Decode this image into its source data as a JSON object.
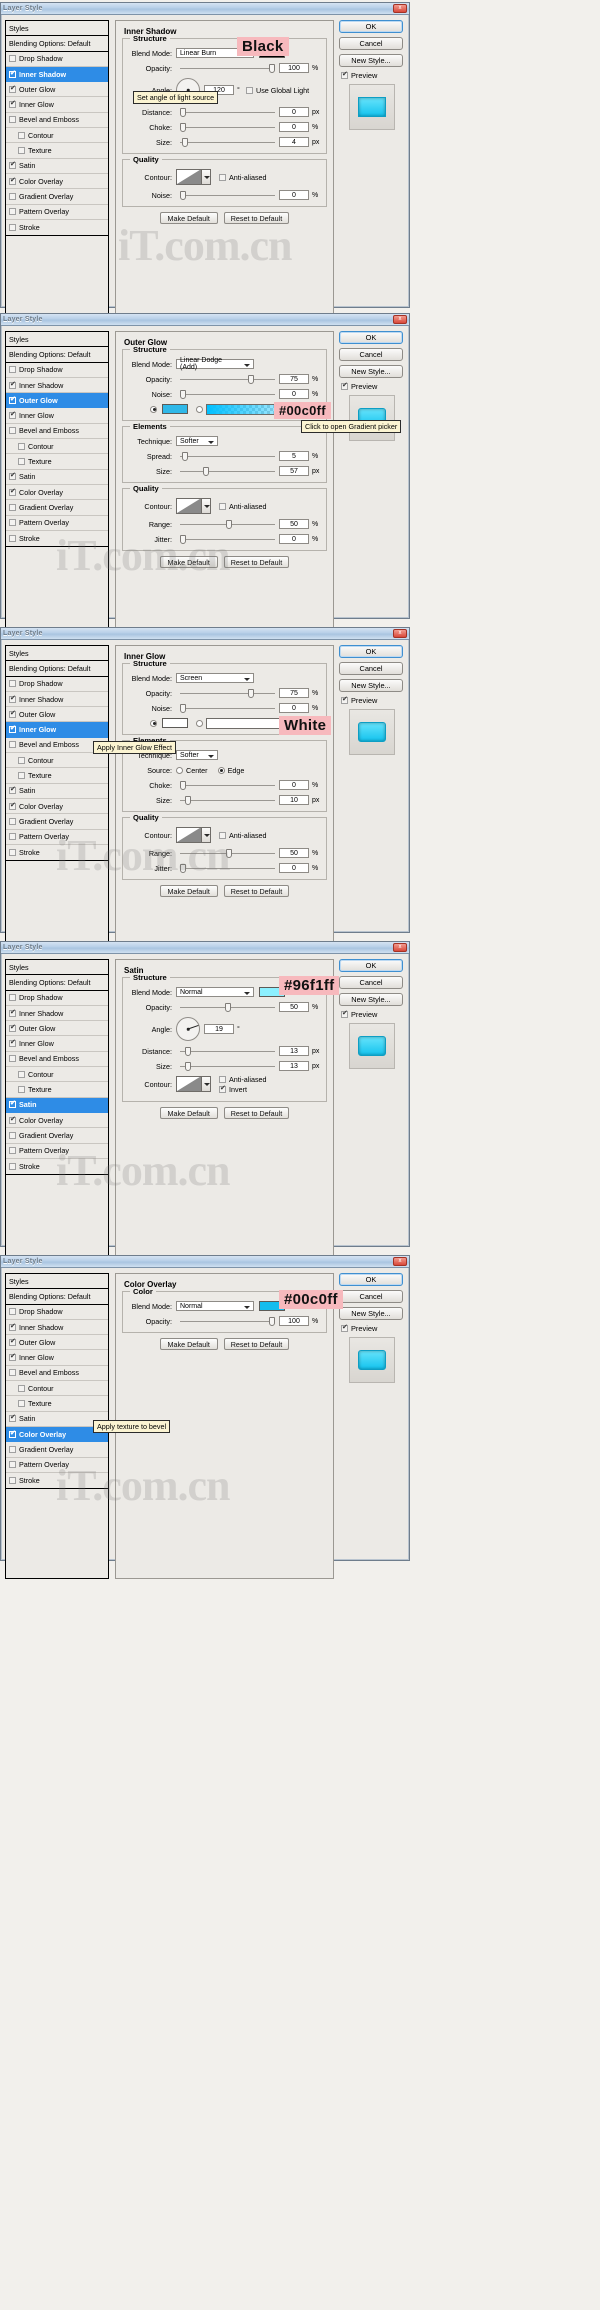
{
  "window": {
    "title": "Layer Style",
    "close_label": "x"
  },
  "styles_panel": {
    "header": "Styles",
    "subheader": "Blending Options: Default",
    "items": [
      {
        "label": "Drop Shadow",
        "checked": false,
        "indent": false
      },
      {
        "label": "Inner Shadow",
        "checked": true,
        "indent": false
      },
      {
        "label": "Outer Glow",
        "checked": true,
        "indent": false
      },
      {
        "label": "Inner Glow",
        "checked": true,
        "indent": false
      },
      {
        "label": "Bevel and Emboss",
        "checked": false,
        "indent": false
      },
      {
        "label": "Contour",
        "checked": false,
        "indent": true
      },
      {
        "label": "Texture",
        "checked": false,
        "indent": true
      },
      {
        "label": "Satin",
        "checked": true,
        "indent": false
      },
      {
        "label": "Color Overlay",
        "checked": true,
        "indent": false
      },
      {
        "label": "Gradient Overlay",
        "checked": false,
        "indent": false
      },
      {
        "label": "Pattern Overlay",
        "checked": false,
        "indent": false
      },
      {
        "label": "Stroke",
        "checked": false,
        "indent": false
      }
    ]
  },
  "buttons": {
    "ok": "OK",
    "cancel": "Cancel",
    "new_style": "New Style...",
    "preview": "Preview",
    "make_default": "Make Default",
    "reset_default": "Reset to Default"
  },
  "labels": {
    "structure": "Structure",
    "quality": "Quality",
    "elements": "Elements",
    "color": "Color",
    "blend_mode": "Blend Mode:",
    "opacity": "Opacity:",
    "noise": "Noise:",
    "angle": "Angle:",
    "distance": "Distance:",
    "choke": "Choke:",
    "size": "Size:",
    "spread": "Spread:",
    "contour": "Contour:",
    "technique": "Technique:",
    "source": "Source:",
    "range": "Range:",
    "jitter": "Jitter:",
    "anti_aliased": "Anti-aliased",
    "use_global_light": "Use Global Light",
    "invert": "Invert",
    "center": "Center",
    "edge": "Edge",
    "pct": "%",
    "px": "px",
    "deg": "°"
  },
  "watermark": "iT.com.cn",
  "panels": [
    {
      "id": "inner-shadow",
      "section_title": "Inner Shadow",
      "selected_style": "Inner Shadow",
      "blend_mode": "Linear Burn",
      "swatch_color": "#000000",
      "annotation": "Black",
      "tooltip": "Set angle of light source",
      "opacity": "100",
      "angle": "120",
      "angle_deg": 120,
      "distance": "0",
      "choke": "0",
      "size": "4",
      "noise": "0",
      "technique": null,
      "spread": null,
      "range": null,
      "jitter": null
    },
    {
      "id": "outer-glow",
      "section_title": "Outer Glow",
      "selected_style": "Outer Glow",
      "blend_mode": "Linear Dodge (Add)",
      "swatch_color": "#00c0ff",
      "annotation": "#00c0ff",
      "tooltip": "Click to open Gradient picker",
      "opacity": "75",
      "noise": "0",
      "technique": "Softer",
      "spread": "5",
      "size": "57",
      "range": "50",
      "jitter": "0"
    },
    {
      "id": "inner-glow",
      "section_title": "Inner Glow",
      "selected_style": "Inner Glow",
      "blend_mode": "Screen",
      "swatch_color": "#ffffff",
      "annotation": "White",
      "tooltip": "Apply Inner Glow Effect",
      "opacity": "75",
      "noise": "0",
      "technique": "Softer",
      "source_center": "Center",
      "source_edge": "Edge",
      "choke": "0",
      "size": "10",
      "range": "50",
      "jitter": "0"
    },
    {
      "id": "satin",
      "section_title": "Satin",
      "selected_style": "Satin",
      "blend_mode": "Normal",
      "swatch_color": "#96f1ff",
      "annotation": "#96f1ff",
      "tooltip": null,
      "opacity": "50",
      "angle": "19",
      "angle_deg": 19,
      "distance": "13",
      "size": "13",
      "invert": true,
      "anti_aliased": false
    },
    {
      "id": "color-overlay",
      "section_title": "Color Overlay",
      "selected_style": "Color Overlay",
      "blend_mode": "Normal",
      "swatch_color": "#00c0ff",
      "annotation": "#00c0ff",
      "tooltip": "Apply texture to bevel",
      "opacity": "100"
    }
  ]
}
